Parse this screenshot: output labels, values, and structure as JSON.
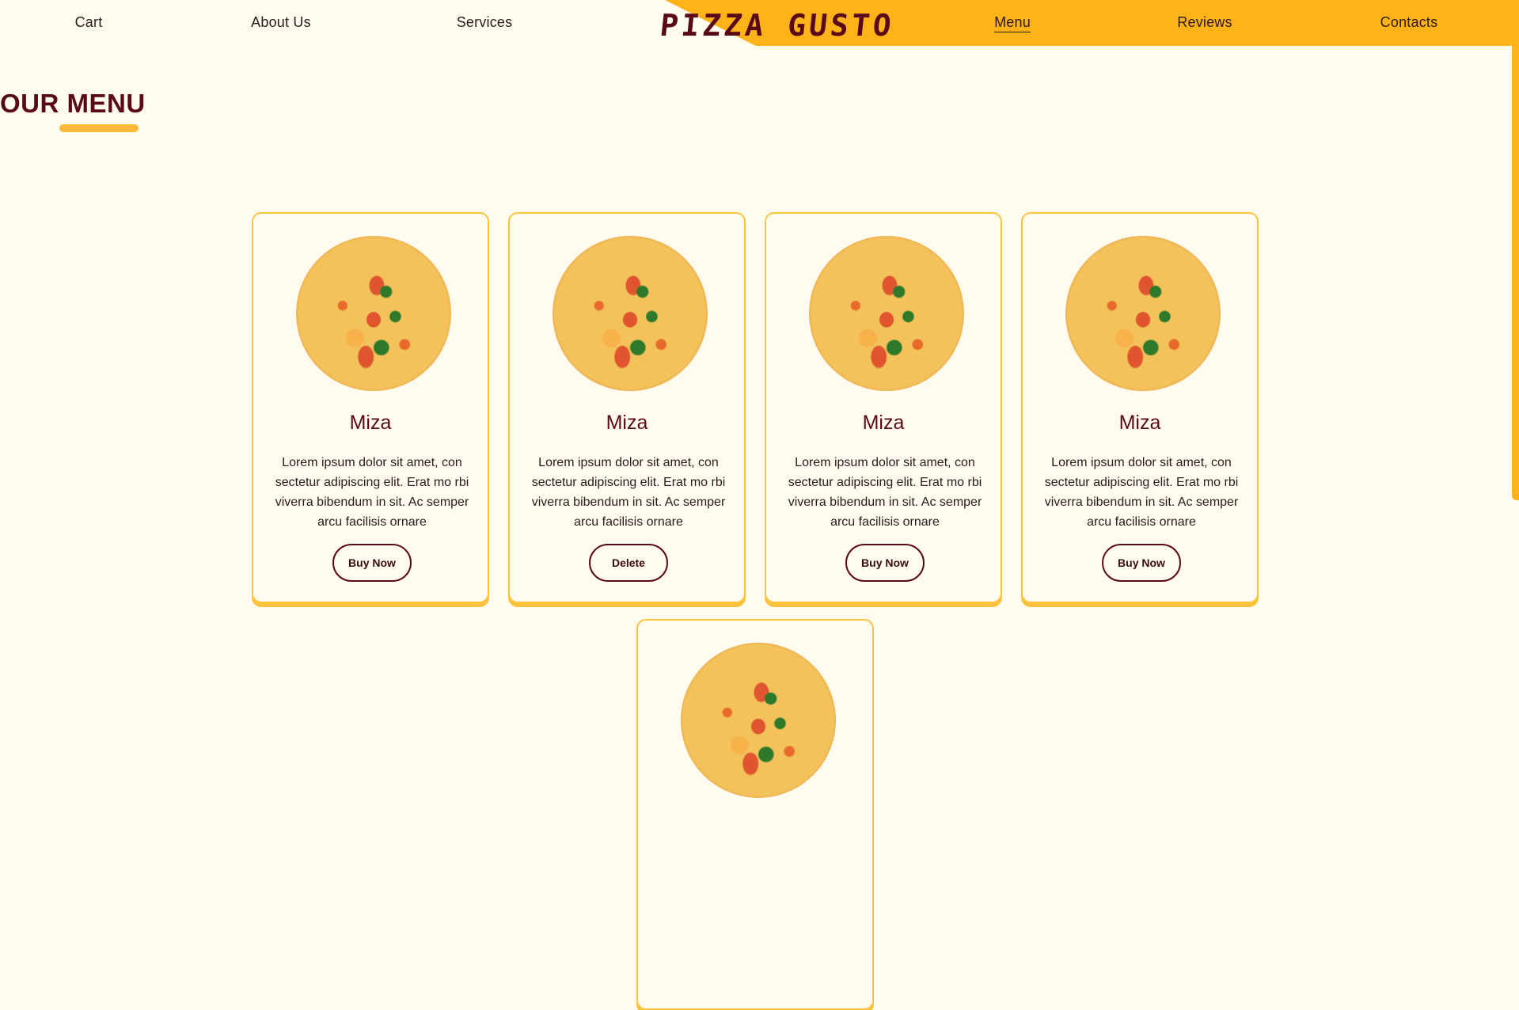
{
  "nav": {
    "items": [
      {
        "label": "Cart"
      },
      {
        "label": "About Us"
      },
      {
        "label": "Services"
      },
      {
        "label": "Menu",
        "active": true
      },
      {
        "label": "Reviews"
      },
      {
        "label": "Contacts"
      }
    ],
    "logo": "PIZZA GUSTO"
  },
  "section": {
    "title": "OUR MENU"
  },
  "cards": [
    {
      "title": "Miza",
      "description": "Lorem ipsum dolor sit amet, con sectetur adipiscing elit. Erat mo rbi viverra bibendum in sit. Ac semper arcu facilisis ornare",
      "button": "Buy Now"
    },
    {
      "title": "Miza",
      "description": "Lorem ipsum dolor sit amet, con sectetur adipiscing elit. Erat mo rbi viverra bibendum in sit. Ac semper arcu facilisis ornare",
      "button": "Delete"
    },
    {
      "title": "Miza",
      "description": "Lorem ipsum dolor sit amet, con sectetur adipiscing elit. Erat mo rbi viverra bibendum in sit. Ac semper arcu facilisis ornare",
      "button": "Buy Now"
    },
    {
      "title": "Miza",
      "description": "Lorem ipsum dolor sit amet, con sectetur adipiscing elit. Erat mo rbi viverra bibendum in sit. Ac semper arcu facilisis ornare",
      "button": "Buy Now"
    }
  ],
  "colors": {
    "accent": "#ffb319",
    "brand": "#5a0a16",
    "background": "#fffcef",
    "card_border": "#ffc23d"
  }
}
